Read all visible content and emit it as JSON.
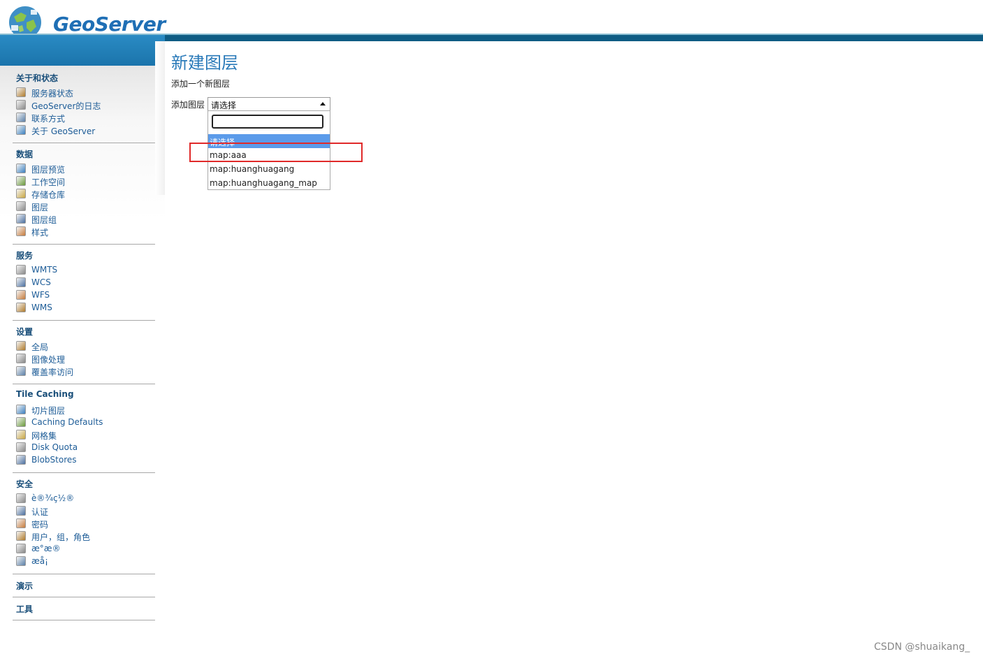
{
  "header": {
    "logo_text": "GeoServer"
  },
  "page": {
    "title": "新建图层",
    "description": "添加一个新图层",
    "field_label": "添加图层",
    "select_value": "请选择",
    "search_value": "",
    "options": [
      {
        "label": "请选择",
        "selected": true
      },
      {
        "label": "map:aaa",
        "selected": false
      },
      {
        "label": "map:huanghuagang",
        "selected": false
      },
      {
        "label": "map:huanghuagang_map",
        "selected": false
      }
    ]
  },
  "sidebar": {
    "sections": [
      {
        "title": "关于和状态",
        "items": [
          {
            "label": "服务器状态",
            "icon": "server-status-icon"
          },
          {
            "label": "GeoServer的日志",
            "icon": "log-file-icon"
          },
          {
            "label": "联系方式",
            "icon": "contact-card-icon"
          },
          {
            "label": "关于 GeoServer",
            "icon": "help-icon"
          }
        ]
      },
      {
        "title": "数据",
        "items": [
          {
            "label": "图层预览",
            "icon": "layer-preview-icon"
          },
          {
            "label": "工作空间",
            "icon": "folder-icon"
          },
          {
            "label": "存储仓库",
            "icon": "database-icon"
          },
          {
            "label": "图层",
            "icon": "layer-icon"
          },
          {
            "label": "图层组",
            "icon": "layer-group-icon"
          },
          {
            "label": "样式",
            "icon": "palette-icon"
          }
        ]
      },
      {
        "title": "服务",
        "items": [
          {
            "label": "WMTS",
            "icon": "wmts-service-icon"
          },
          {
            "label": "WCS",
            "icon": "wcs-service-icon"
          },
          {
            "label": "WFS",
            "icon": "wfs-service-icon"
          },
          {
            "label": "WMS",
            "icon": "wms-service-icon"
          }
        ]
      },
      {
        "title": "设置",
        "items": [
          {
            "label": "全局",
            "icon": "global-settings-icon"
          },
          {
            "label": "图像处理",
            "icon": "image-processing-icon"
          },
          {
            "label": "覆盖率访问",
            "icon": "coverage-access-icon"
          }
        ]
      },
      {
        "title": "Tile Caching",
        "items": [
          {
            "label": "切片图层",
            "icon": "tile-layers-icon"
          },
          {
            "label": "Caching Defaults",
            "icon": "globe-icon"
          },
          {
            "label": "网格集",
            "icon": "gridset-icon"
          },
          {
            "label": "Disk Quota",
            "icon": "disk-icon"
          },
          {
            "label": "BlobStores",
            "icon": "blobstore-icon"
          }
        ]
      },
      {
        "title": "安全",
        "items": [
          {
            "label": "è®¾ç½®",
            "icon": "wrench-icon"
          },
          {
            "label": "认证",
            "icon": "shield-icon"
          },
          {
            "label": "密码",
            "icon": "lock-icon"
          },
          {
            "label": "用户，组，角色",
            "icon": "users-icon"
          },
          {
            "label": "æ°æ®",
            "icon": "data-security-icon"
          },
          {
            "label": "æå¡",
            "icon": "service-security-icon"
          }
        ]
      },
      {
        "title": "演示",
        "items": []
      },
      {
        "title": "工具",
        "items": []
      }
    ]
  },
  "watermark": "CSDN @shuaikang_",
  "colors": {
    "brand_blue": "#1f6fb5",
    "band_dark": "#0e5c84",
    "link_blue": "#1d5c97",
    "selected_option": "#5b9bea",
    "highlight_red": "#e02a2a"
  }
}
